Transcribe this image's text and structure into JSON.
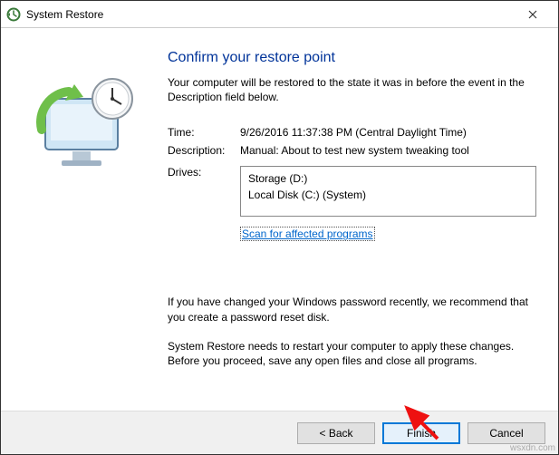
{
  "window": {
    "title": "System Restore"
  },
  "heading": "Confirm your restore point",
  "intro": "Your computer will be restored to the state it was in before the event in the Description field below.",
  "fields": {
    "time_label": "Time:",
    "time_value": "9/26/2016 11:37:38 PM (Central Daylight Time)",
    "description_label": "Description:",
    "description_value": "Manual: About to test new system tweaking tool",
    "drives_label": "Drives:",
    "drives": [
      "Storage (D:)",
      "Local Disk (C:) (System)"
    ]
  },
  "scan_link": "Scan for affected programs",
  "note_password": "If you have changed your Windows password recently, we recommend that you create a password reset disk.",
  "note_restart": "System Restore needs to restart your computer to apply these changes. Before you proceed, save any open files and close all programs.",
  "buttons": {
    "back": "< Back",
    "finish": "Finish",
    "cancel": "Cancel"
  },
  "watermark": "wsxdn.com"
}
